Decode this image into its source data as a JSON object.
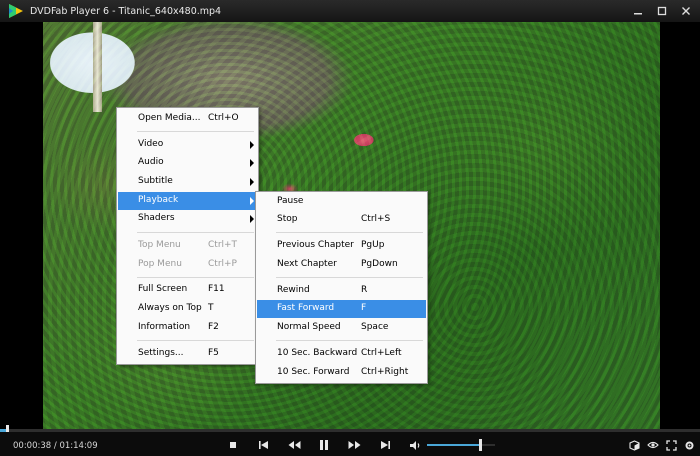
{
  "window": {
    "title": "DVDFab Player 6 - Titanic_640x480.mp4"
  },
  "context_menu": {
    "items": [
      {
        "label": "Open Media...",
        "shortcut": "Ctrl+O"
      },
      {
        "label": "Video",
        "shortcut": ""
      },
      {
        "label": "Audio",
        "shortcut": ""
      },
      {
        "label": "Subtitle",
        "shortcut": ""
      },
      {
        "label": "Playback",
        "shortcut": ""
      },
      {
        "label": "Shaders",
        "shortcut": ""
      },
      {
        "label": "Top Menu",
        "shortcut": "Ctrl+T"
      },
      {
        "label": "Pop Menu",
        "shortcut": "Ctrl+P"
      },
      {
        "label": "Full Screen",
        "shortcut": "F11"
      },
      {
        "label": "Always on Top",
        "shortcut": "T"
      },
      {
        "label": "Information",
        "shortcut": "F2"
      },
      {
        "label": "Settings...",
        "shortcut": "F5"
      }
    ],
    "selected_item": "Playback"
  },
  "playback_submenu": {
    "items": [
      {
        "label": "Pause",
        "shortcut": ""
      },
      {
        "label": "Stop",
        "shortcut": "Ctrl+S"
      },
      {
        "label": "Previous Chapter",
        "shortcut": "PgUp"
      },
      {
        "label": "Next Chapter",
        "shortcut": "PgDown"
      },
      {
        "label": "Rewind",
        "shortcut": "R"
      },
      {
        "label": "Fast Forward",
        "shortcut": "F"
      },
      {
        "label": "Normal Speed",
        "shortcut": "Space"
      },
      {
        "label": "10 Sec. Backward",
        "shortcut": "Ctrl+Left"
      },
      {
        "label": "10 Sec. Forward",
        "shortcut": "Ctrl+Right"
      }
    ],
    "selected_item": "Fast Forward"
  },
  "controls": {
    "time_display": "00:00:38 / 01:14:09",
    "seek_progress": 0.0085,
    "volume_level": 0.78
  },
  "colors": {
    "highlight": "#3a8ee6",
    "accent": "#4aa7d8"
  }
}
